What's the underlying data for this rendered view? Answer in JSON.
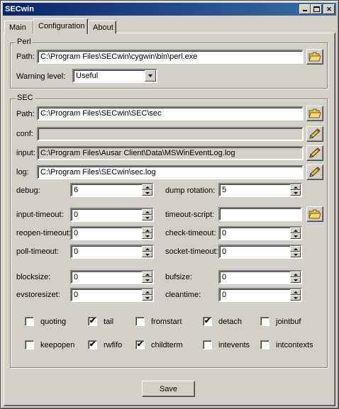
{
  "window": {
    "title": "SECwin"
  },
  "tabs": [
    {
      "label": "Main"
    },
    {
      "label": "Configuration"
    },
    {
      "label": "About"
    }
  ],
  "perl": {
    "group_title": "Perl",
    "path_label": "Path:",
    "path_value": "C:\\Program Files\\SECwin\\cygwin\\bin\\perl.exe",
    "warning_label": "Warning level:",
    "warning_value": "Useful"
  },
  "sec": {
    "group_title": "SEC",
    "path_label": "Path:",
    "path_value": "C:\\Program Files\\SECwin\\SEC\\sec",
    "conf_label": "conf:",
    "conf_value": "",
    "input_label": "input:",
    "input_value": "C:\\Program Files\\Ausar Client\\Data\\MSWinEventLog.log",
    "log_label": "log:",
    "log_value": "C:\\Program Files\\SECwin\\sec.log",
    "debug_label": "debug:",
    "debug_value": "6",
    "dump_rotation_label": "dump rotation:",
    "dump_rotation_value": "5",
    "input_timeout_label": "input-timeout:",
    "input_timeout_value": "0",
    "timeout_script_label": "timeout-script:",
    "timeout_script_value": "",
    "reopen_timeout_label": "reopen-timeout:",
    "reopen_timeout_value": "0",
    "check_timeout_label": "check-timeout:",
    "check_timeout_value": "0",
    "poll_timeout_label": "poll-timeout:",
    "poll_timeout_value": "0",
    "socket_timeout_label": "socket-timeout:",
    "socket_timeout_value": "0",
    "blocksize_label": "blocksize:",
    "blocksize_value": "0",
    "bufsize_label": "bufsize:",
    "bufsize_value": "0",
    "evstoresize_label": "evstoresizet:",
    "evstoresize_value": "0",
    "cleantime_label": "cleantime:",
    "cleantime_value": "0"
  },
  "checkboxes": {
    "quoting": {
      "label": "quoting",
      "checked": false
    },
    "tail": {
      "label": "tail",
      "checked": true
    },
    "fromstart": {
      "label": "fromstart",
      "checked": false
    },
    "detach": {
      "label": "detach",
      "checked": true
    },
    "jointbuf": {
      "label": "jointbuf",
      "checked": false
    },
    "keepopen": {
      "label": "keepopen",
      "checked": false
    },
    "rwfifo": {
      "label": "rwfifo",
      "checked": true
    },
    "childterm": {
      "label": "childterm",
      "checked": true
    },
    "intevents": {
      "label": "intevents",
      "checked": false
    },
    "intcontexts": {
      "label": "intcontexts",
      "checked": false
    }
  },
  "buttons": {
    "save_label": "Save"
  },
  "icons": {
    "browse": "folder-open-icon",
    "edit": "pencil-icon",
    "minimize": "minimize-icon",
    "maximize": "maximize-icon",
    "close": "close-icon"
  },
  "colors": {
    "face": "#d4d0c8",
    "title_start": "#0a246a",
    "title_end": "#3a6ea5"
  }
}
